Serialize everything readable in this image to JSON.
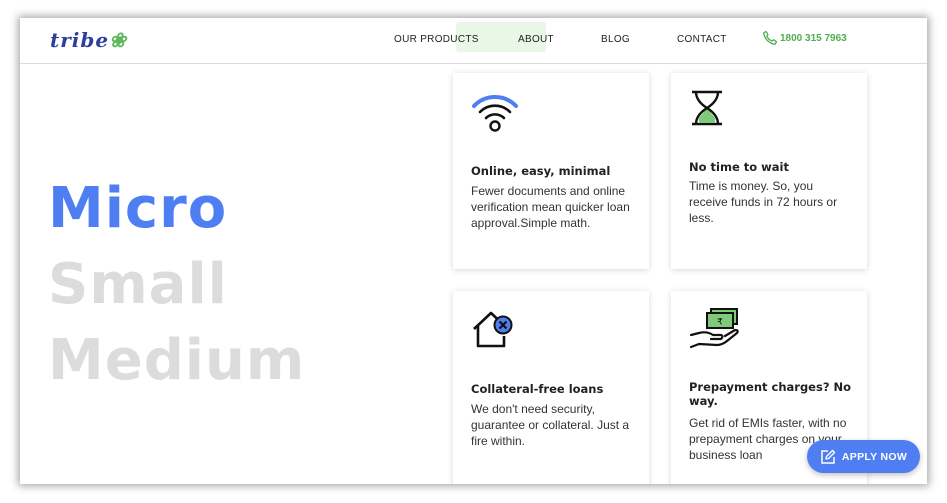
{
  "header": {
    "logo_text": "tribe",
    "nav": [
      "OUR PRODUCTS",
      "ABOUT",
      "BLOG",
      "CONTACT"
    ],
    "phone": "1800 315 7963"
  },
  "hero": {
    "words": [
      "Micro",
      "Small",
      "Medium"
    ],
    "active_word": "Micro"
  },
  "cards": [
    {
      "icon": "wifi-icon",
      "title": "Online, easy, minimal",
      "body": "Fewer documents and online verification mean quicker loan approval.Simple math."
    },
    {
      "icon": "hourglass-icon",
      "title": "No time to wait",
      "body": "Time is money. So, you receive funds in 72 hours or less."
    },
    {
      "icon": "house-cross-icon",
      "title": "Collateral-free loans",
      "body": "We don't need security, guarantee or collateral. Just a fire within."
    },
    {
      "icon": "hand-money-icon",
      "title": "Prepayment charges? No way.",
      "body": "Get rid of EMIs faster, with no prepayment charges on your business loan"
    }
  ],
  "apply_button": {
    "label": "APPLY NOW"
  },
  "colors": {
    "accent": "#4e7ef2",
    "phone": "#4caf50",
    "dim_word": "#dcdcdc"
  }
}
